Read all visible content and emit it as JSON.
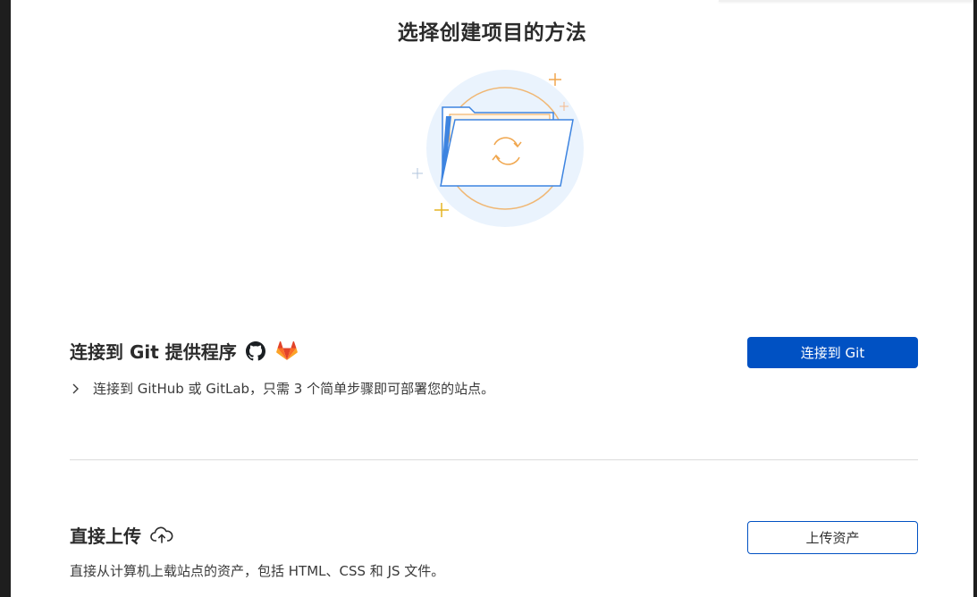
{
  "page": {
    "title": "选择创建项目的方法"
  },
  "git_section": {
    "title": "连接到 Git 提供程序",
    "description": "连接到 GitHub 或 GitLab，只需 3 个简单步骤即可部署您的站点。",
    "button_label": "连接到 Git",
    "icons": [
      "github-icon",
      "gitlab-icon",
      "chevron-right-icon"
    ]
  },
  "upload_section": {
    "title": "直接上传",
    "description": "直接从计算机上载站点的资产，包括 HTML、CSS 和 JS 文件。",
    "button_label": "上传资产",
    "icons": [
      "cloud-upload-icon"
    ]
  },
  "colors": {
    "primary": "#0051c3",
    "illustration_circle": "#eaf3fd",
    "illustration_orange": "#f0a64d",
    "illustration_blue": "#3d84e0"
  }
}
